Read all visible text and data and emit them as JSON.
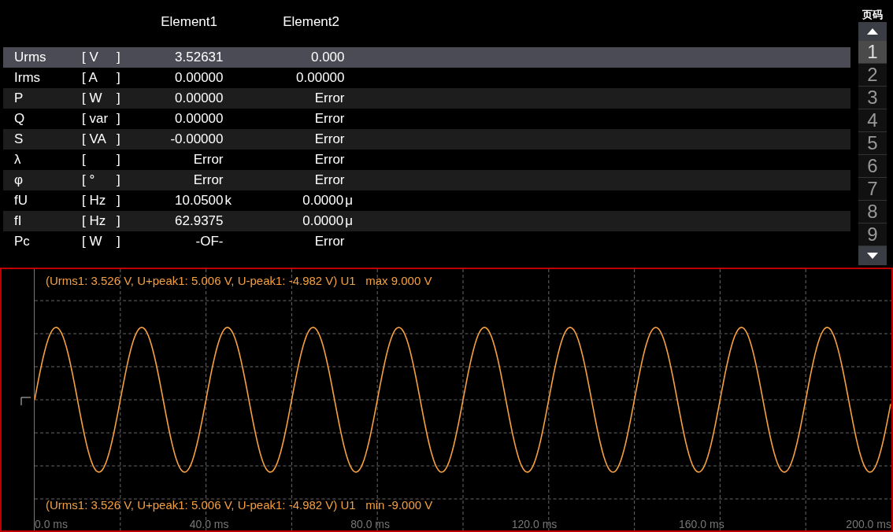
{
  "table": {
    "columns": [
      "Element1",
      "Element2"
    ],
    "rows": [
      {
        "name": "Urms",
        "unit": "[ V",
        "unit_close": "]",
        "selected": true,
        "values": [
          {
            "value": "3.52631"
          },
          {
            "value": "0.000"
          }
        ]
      },
      {
        "name": "Irms",
        "unit": "[ A",
        "unit_close": "]",
        "selected": false,
        "values": [
          {
            "value": "0.00000"
          },
          {
            "value": "0.00000"
          }
        ]
      },
      {
        "name": "P",
        "unit": "[ W",
        "unit_close": "]",
        "selected": false,
        "values": [
          {
            "value": "0.00000"
          },
          {
            "value": "Error"
          }
        ]
      },
      {
        "name": "Q",
        "unit": "[ var",
        "unit_close": "]",
        "selected": false,
        "values": [
          {
            "value": "0.00000"
          },
          {
            "value": "Error"
          }
        ]
      },
      {
        "name": "S",
        "unit": "[ VA",
        "unit_close": "]",
        "selected": false,
        "values": [
          {
            "value": "-0.00000"
          },
          {
            "value": "Error"
          }
        ]
      },
      {
        "name": "λ",
        "unit": "[",
        "unit_close": "]",
        "selected": false,
        "values": [
          {
            "value": "Error"
          },
          {
            "value": "Error"
          }
        ]
      },
      {
        "name": "φ",
        "unit": "[ °",
        "unit_close": "]",
        "selected": false,
        "values": [
          {
            "value": "Error"
          },
          {
            "value": "Error"
          }
        ]
      },
      {
        "name": "fU",
        "unit": "[ Hz",
        "unit_close": "]",
        "selected": false,
        "values": [
          {
            "value": "10.0500",
            "prefix": "k"
          },
          {
            "value": "0.0000",
            "prefix": "μ"
          }
        ]
      },
      {
        "name": "fI",
        "unit": "[ Hz",
        "unit_close": "]",
        "selected": false,
        "values": [
          {
            "value": "62.9375"
          },
          {
            "value": "0.0000",
            "prefix": "μ"
          }
        ]
      },
      {
        "name": "Pc",
        "unit": "[ W",
        "unit_close": "]",
        "selected": false,
        "values": [
          {
            "value": "-OF-"
          },
          {
            "value": "Error"
          }
        ]
      }
    ]
  },
  "pager": {
    "title": "页码",
    "pages": [
      {
        "label": "1",
        "selected": true
      },
      {
        "label": "2",
        "selected": false
      },
      {
        "label": "3",
        "selected": false
      },
      {
        "label": "4",
        "selected": false
      },
      {
        "label": "5",
        "selected": false
      },
      {
        "label": "6",
        "selected": false
      },
      {
        "label": "7",
        "selected": false
      },
      {
        "label": "8",
        "selected": false
      },
      {
        "label": "9",
        "selected": false
      }
    ]
  },
  "waveform": {
    "max_caption": "(Urms1: 3.526 V, U+peak1: 5.006 V, U-peak1: -4.982 V) U1   max 9.000 V",
    "min_caption": "(Urms1: 3.526 V, U+peak1: 5.006 V, U-peak1: -4.982 V) U1   min -9.000 V",
    "x_labels": [
      "0.0 ms",
      "40.0 ms",
      "80.0 ms",
      "120.0 ms",
      "160.0 ms",
      "200.0 ms"
    ]
  }
}
